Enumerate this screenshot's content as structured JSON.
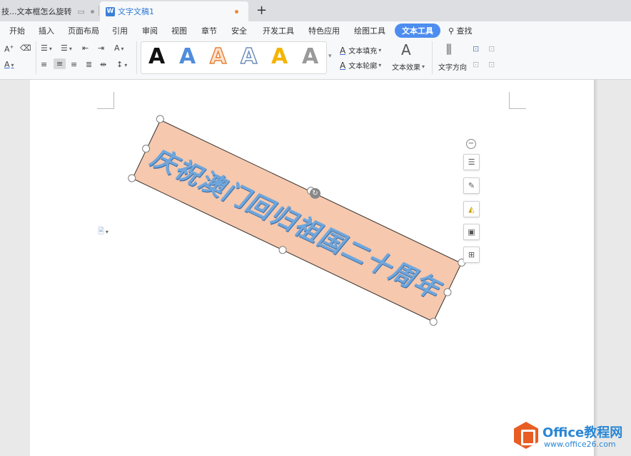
{
  "tabs": [
    {
      "label": "技...文本框怎么旋转"
    },
    {
      "label": "文字文稿1",
      "icon": "W"
    }
  ],
  "new_tab": "+",
  "menu": [
    "开始",
    "插入",
    "页面布局",
    "引用",
    "审阅",
    "视图",
    "章节",
    "安全",
    "开发工具",
    "特色应用",
    "绘图工具",
    "文本工具"
  ],
  "menu_active": "文本工具",
  "search_label": "查找",
  "toolbar": {
    "font_grow": "A",
    "font_color": "A",
    "style_glyph": "A",
    "text_fill": "文本填充",
    "text_outline": "文本轮廓",
    "text_effect": "文本效果",
    "text_direction": "文字方向",
    "effect_glyph": "A"
  },
  "textbox": {
    "text": "庆祝澳门回归祖国二十周年",
    "fill_color": "#f6c8ad",
    "text_color": "#6fa6dc",
    "rotation_deg": 25.5
  },
  "watermark": {
    "brand": "Office教程网",
    "url": "www.office26.com"
  },
  "colors": {
    "accent": "#4d8df0",
    "tab_active_text": "#2f7bd8",
    "unsaved_dot": "#e98a3a"
  }
}
